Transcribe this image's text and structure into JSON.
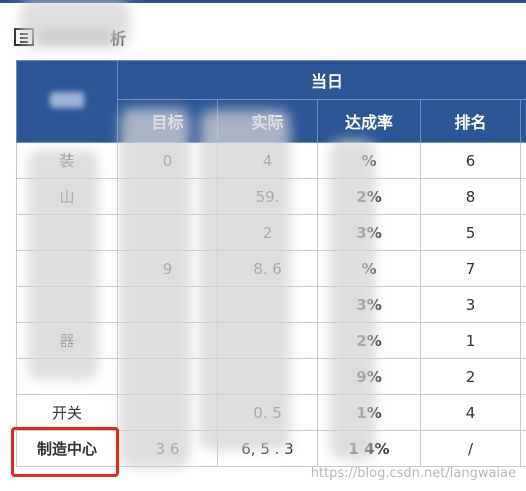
{
  "title": {
    "suffix": "析"
  },
  "table": {
    "group_header": "当日",
    "columns": [
      "目标",
      "实际",
      "达成率",
      "排名"
    ],
    "rows": [
      {
        "name": "装",
        "target": "0",
        "actual": "4",
        "rate": "%",
        "rate_color": "red",
        "rank": "6"
      },
      {
        "name": "山",
        "target": "",
        "actual": "59.",
        "rate": "2%",
        "rate_color": "red",
        "rank": "8"
      },
      {
        "name": "",
        "target": "",
        "actual": "2",
        "rate": "3%",
        "rate_color": "blue",
        "rank": "5"
      },
      {
        "name": "",
        "target": "9",
        "actual": "8. 6",
        "rate": "%",
        "rate_color": "red",
        "rank": "7"
      },
      {
        "name": "",
        "target": "",
        "actual": "",
        "rate": "3%",
        "rate_color": "blue",
        "rank": "3"
      },
      {
        "name": "器",
        "target": "",
        "actual": "",
        "rate": "2%",
        "rate_color": "blue",
        "rank": "1"
      },
      {
        "name": "",
        "target": "",
        "actual": "",
        "rate": "9%",
        "rate_color": "blue",
        "rank": "2"
      },
      {
        "name": "开关",
        "target": "",
        "actual": "0. 5",
        "rate": "1%",
        "rate_color": "blue",
        "rank": "4"
      },
      {
        "name": "制造中心",
        "target": "3 6",
        "actual": "6, 5 . 3",
        "rate": "1 4%",
        "rate_color": "blue",
        "rank": "/"
      }
    ]
  },
  "watermark": "https://blog.csdn.net/langwaiae",
  "colors": {
    "header_bg": "#2b5797",
    "rate_red": "#e0302a",
    "rate_blue": "#2b5797",
    "highlight": "#e8261c"
  }
}
